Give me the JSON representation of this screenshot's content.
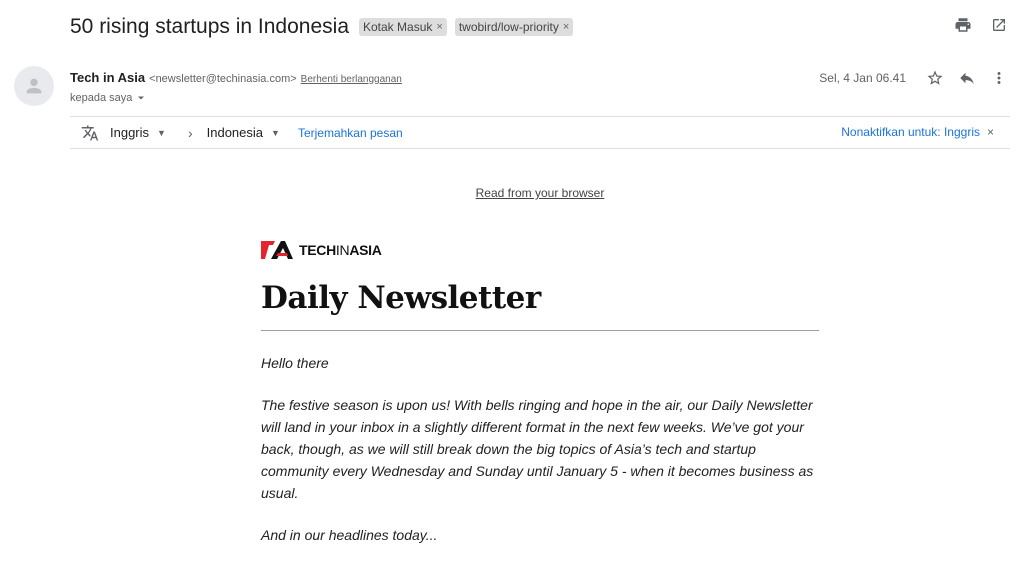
{
  "subject": "50 rising startups in Indonesia",
  "labels": [
    {
      "text": "Kotak Masuk",
      "remove": "×"
    },
    {
      "text": "twobird/low-priority",
      "remove": "×"
    }
  ],
  "top_actions": {
    "print_icon": "print-icon",
    "open_new_window_icon": "open-in-new-window-icon"
  },
  "sender": {
    "name": "Tech in Asia",
    "email": "<newsletter@techinasia.com>",
    "unsubscribe": "Berhenti berlangganan",
    "to": "kepada saya"
  },
  "meta": {
    "date": "Sel, 4 Jan 06.41"
  },
  "translate": {
    "from_lang": "Inggris",
    "to_lang": "Indonesia",
    "translate_link": "Terjemahkan pesan",
    "disable_link": "Nonaktifkan untuk: Inggris",
    "close": "×"
  },
  "email": {
    "browser_link": "Read from your browser",
    "logo_text_bold": "TECH",
    "logo_text_thin": "IN",
    "logo_text_bold2": "ASIA",
    "title": "Daily Newsletter",
    "greeting": "Hello there",
    "intro": "The festive season is upon us! With bells ringing and hope in the air, our Daily Newsletter will land in your inbox in a slightly different format in the next few weeks. We’ve got your back, though, as we will still break down the big topics of Asia’s tech and startup community every Wednesday and Sunday until January 5 - when it becomes business as usual.",
    "headlines": "And in our headlines today..."
  },
  "colors": {
    "accent": "#1a73e8",
    "logo_red": "#e6232c",
    "chip_bg": "#dddddd"
  }
}
